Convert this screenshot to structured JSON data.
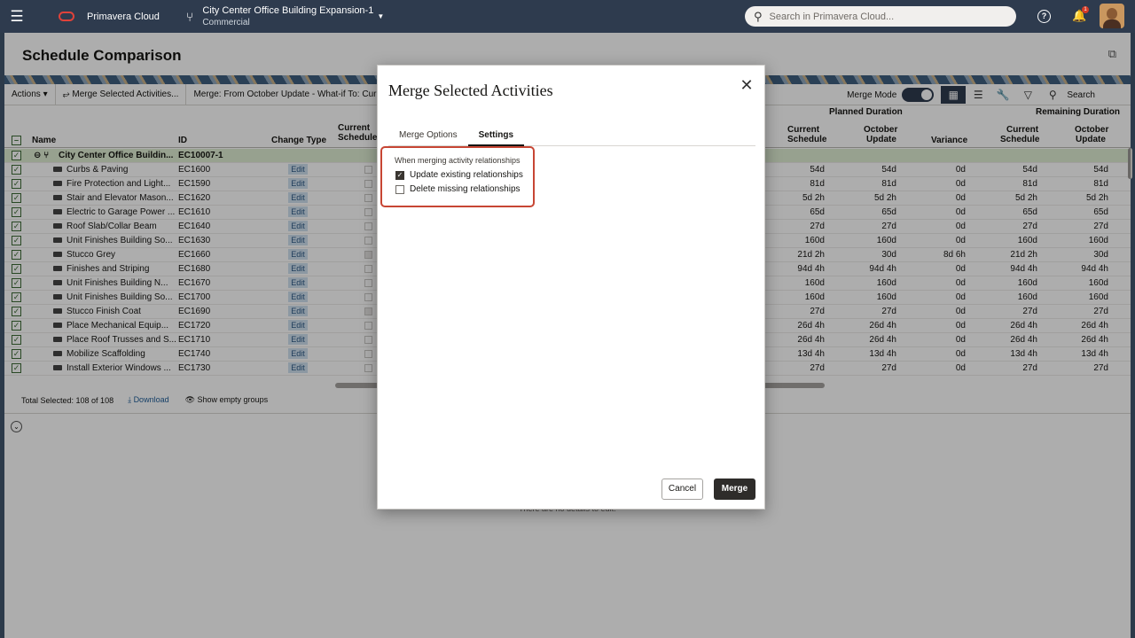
{
  "nav": {
    "brand": "Primavera Cloud",
    "project_title": "City Center Office Building Expansion-1",
    "project_subtitle": "Commercial",
    "search_placeholder": "Search in Primavera Cloud...",
    "notification_count": "1"
  },
  "page": {
    "title": "Schedule Comparison",
    "toolbar": {
      "actions": "Actions",
      "merge_selected": "Merge Selected Activities...",
      "merge_from_label": "Merge: From",
      "merge_from_value": "October Update - What-if",
      "to_label": "To:",
      "to_value": "Curr",
      "merge_mode": "Merge Mode",
      "search": "Search"
    },
    "grid": {
      "headers": {
        "name": "Name",
        "id": "ID",
        "change_type": "Change Type",
        "current_schedule_1": "Current",
        "current_schedule_2": "Schedule",
        "planned_duration": "Planned Duration",
        "remaining_duration": "Remaining Duration",
        "pd_current_1": "Current",
        "pd_current_2": "Schedule",
        "pd_october_1": "October",
        "pd_october_2": "Update",
        "pd_variance": "Variance",
        "rd_current_1": "Current",
        "rd_current_2": "Schedule",
        "rd_october_1": "October",
        "rd_october_2": "Update"
      },
      "group_row": {
        "name": "City Center Office Buildin...",
        "id": "EC10007-1"
      },
      "edit_label": "Edit",
      "rows": [
        {
          "name": "Curbs & Paving",
          "id": "EC1600",
          "pd_cur": "54d",
          "pd_oct": "54d",
          "var": "0d",
          "rd_cur": "54d",
          "rd_oct": "54d"
        },
        {
          "name": "Fire Protection and Light...",
          "id": "EC1590",
          "pd_cur": "81d",
          "pd_oct": "81d",
          "var": "0d",
          "rd_cur": "81d",
          "rd_oct": "81d"
        },
        {
          "name": "Stair and Elevator Mason...",
          "id": "EC1620",
          "pd_cur": "5d 2h",
          "pd_oct": "5d 2h",
          "var": "0d",
          "rd_cur": "5d 2h",
          "rd_oct": "5d 2h"
        },
        {
          "name": "Electric to Garage Power ...",
          "id": "EC1610",
          "pd_cur": "65d",
          "pd_oct": "65d",
          "var": "0d",
          "rd_cur": "65d",
          "rd_oct": "65d"
        },
        {
          "name": "Roof Slab/Collar Beam",
          "id": "EC1640",
          "pd_cur": "27d",
          "pd_oct": "27d",
          "var": "0d",
          "rd_cur": "27d",
          "rd_oct": "27d"
        },
        {
          "name": "Unit Finishes Building So...",
          "id": "EC1630",
          "pd_cur": "160d",
          "pd_oct": "160d",
          "var": "0d",
          "rd_cur": "160d",
          "rd_oct": "160d"
        },
        {
          "name": "Stucco Grey",
          "id": "EC1660",
          "pd_cur": "21d 2h",
          "pd_oct": "30d",
          "var": "8d 6h",
          "rd_cur": "21d 2h",
          "rd_oct": "30d"
        },
        {
          "name": "Finishes and Striping",
          "id": "EC1680",
          "pd_cur": "94d 4h",
          "pd_oct": "94d 4h",
          "var": "0d",
          "rd_cur": "94d 4h",
          "rd_oct": "94d 4h"
        },
        {
          "name": "Unit Finishes Building N...",
          "id": "EC1670",
          "pd_cur": "160d",
          "pd_oct": "160d",
          "var": "0d",
          "rd_cur": "160d",
          "rd_oct": "160d"
        },
        {
          "name": "Unit Finishes Building So...",
          "id": "EC1700",
          "pd_cur": "160d",
          "pd_oct": "160d",
          "var": "0d",
          "rd_cur": "160d",
          "rd_oct": "160d"
        },
        {
          "name": "Stucco Finish Coat",
          "id": "EC1690",
          "pd_cur": "27d",
          "pd_oct": "27d",
          "var": "0d",
          "rd_cur": "27d",
          "rd_oct": "27d"
        },
        {
          "name": "Place Mechanical Equip...",
          "id": "EC1720",
          "pd_cur": "26d 4h",
          "pd_oct": "26d 4h",
          "var": "0d",
          "rd_cur": "26d 4h",
          "rd_oct": "26d 4h"
        },
        {
          "name": "Place Roof Trusses and S...",
          "id": "EC1710",
          "pd_cur": "26d 4h",
          "pd_oct": "26d 4h",
          "var": "0d",
          "rd_cur": "26d 4h",
          "rd_oct": "26d 4h"
        },
        {
          "name": "Mobilize Scaffolding",
          "id": "EC1740",
          "pd_cur": "13d 4h",
          "pd_oct": "13d 4h",
          "var": "0d",
          "rd_cur": "13d 4h",
          "rd_oct": "13d 4h"
        },
        {
          "name": "Install Exterior Windows ...",
          "id": "EC1730",
          "pd_cur": "27d",
          "pd_oct": "27d",
          "var": "0d",
          "rd_cur": "27d",
          "rd_oct": "27d"
        }
      ]
    },
    "footer": {
      "total_selected": "Total Selected: 108 of 108",
      "download": "Download",
      "show_empty_groups": "Show empty groups"
    },
    "empty_details": "There are no details to edit."
  },
  "modal": {
    "title": "Merge Selected Activities",
    "tabs": [
      "Merge Options",
      "Settings"
    ],
    "settings_label": "When merging activity relationships",
    "options": [
      {
        "label": "Update existing relationships",
        "checked": true
      },
      {
        "label": "Delete missing relationships",
        "checked": false
      }
    ],
    "cancel": "Cancel",
    "merge": "Merge"
  }
}
